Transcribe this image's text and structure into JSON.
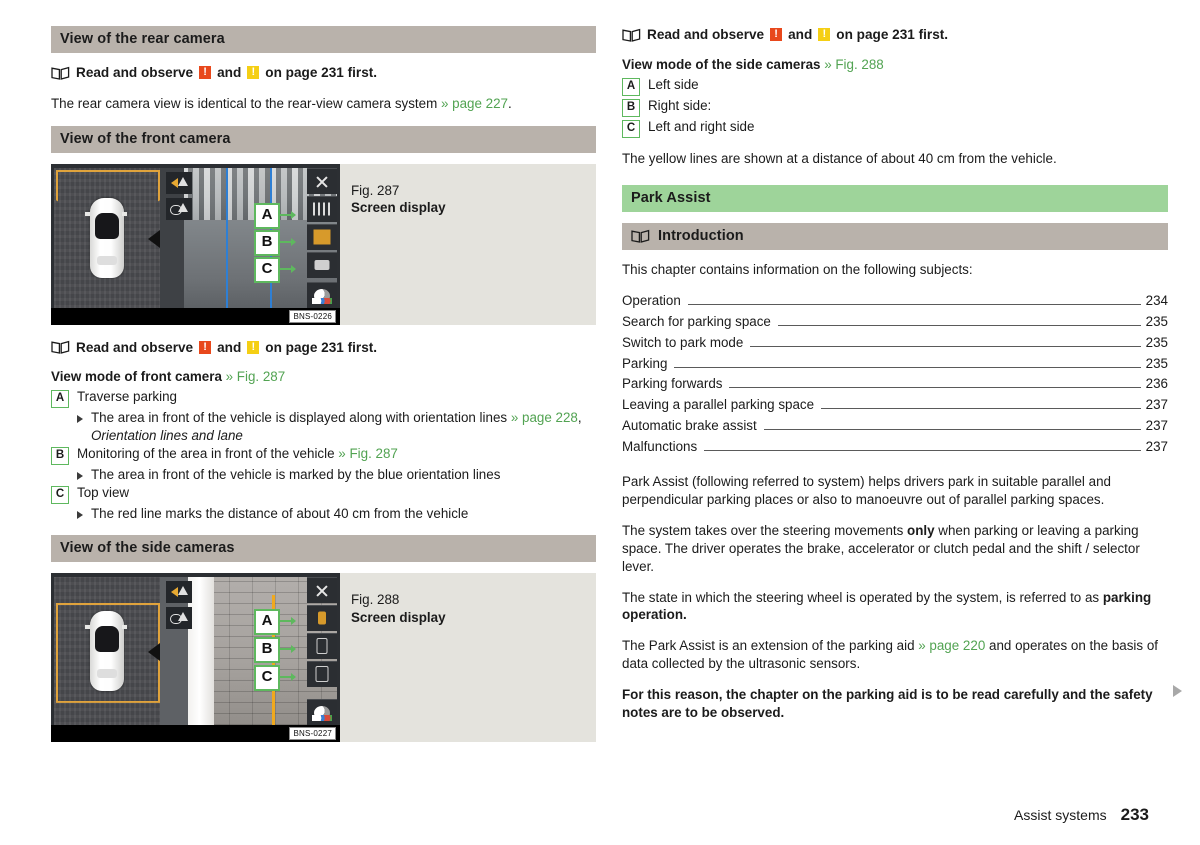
{
  "document": {
    "footer_chapter": "Assist systems",
    "footer_page": "233"
  },
  "left_column": {
    "section_rear": {
      "heading": "View of the rear camera",
      "note": {
        "prefix": "Read and observe",
        "middle": "and",
        "suffix": "on page 231 first.",
        "warn_red": "!",
        "warn_yellow": "!"
      },
      "paragraph": "The rear camera view is identical to the rear-view camera system",
      "paragraph_xref": "» page 227",
      "paragraph_end": "."
    },
    "section_front": {
      "heading": "View of the front camera",
      "figure": {
        "caption_line1": "Fig. 287",
        "caption_line2": "Screen display",
        "code": "BNS-0226",
        "callouts": [
          "A",
          "B",
          "C"
        ]
      },
      "note": {
        "prefix": "Read and observe",
        "middle": "and",
        "suffix": "on page 231 first.",
        "warn_red": "!",
        "warn_yellow": "!"
      },
      "subhead": "View mode of front camera",
      "subhead_xref": "» Fig. 287",
      "items": [
        {
          "letter": "A",
          "text": "Traverse parking",
          "bullets": [
            {
              "text": "The area in front of the vehicle is displayed along with orientation lines",
              "xref": "» page 228",
              "after_xref": ", ",
              "italic": "Orientation lines and lane"
            }
          ]
        },
        {
          "letter": "B",
          "text": "Monitoring of the area in front of the vehicle",
          "xref": "» Fig. 287",
          "bullets": [
            {
              "text": "The area in front of the vehicle is marked by the blue orientation lines"
            }
          ]
        },
        {
          "letter": "C",
          "text": "Top view",
          "bullets": [
            {
              "text": "The red line marks the distance of about 40 cm from the vehicle"
            }
          ]
        }
      ]
    },
    "section_side": {
      "heading": "View of the side cameras",
      "figure": {
        "caption_line1": "Fig. 288",
        "caption_line2": "Screen display",
        "code": "BNS-0227",
        "callouts": [
          "A",
          "B",
          "C"
        ]
      }
    }
  },
  "right_column": {
    "note": {
      "prefix": "Read and observe",
      "middle": "and",
      "suffix": "on page 231 first.",
      "warn_red": "!",
      "warn_yellow": "!"
    },
    "subhead": "View mode of the side cameras",
    "subhead_xref": "» Fig. 288",
    "items": [
      {
        "letter": "A",
        "text": "Left side"
      },
      {
        "letter": "B",
        "text": "Right side:"
      },
      {
        "letter": "C",
        "text": "Left and right side"
      }
    ],
    "yellow_note": "The yellow lines are shown at a distance of about 40 cm from the vehicle.",
    "chapter_bar": "Park Assist",
    "intro_bar": "Introduction",
    "intro_lead": "This chapter contains information on the following subjects:",
    "toc": [
      {
        "label": "Operation",
        "page": "234"
      },
      {
        "label": "Search for parking space",
        "page": "235"
      },
      {
        "label": "Switch to park mode",
        "page": "235"
      },
      {
        "label": "Parking",
        "page": "235"
      },
      {
        "label": "Parking forwards",
        "page": "236"
      },
      {
        "label": "Leaving a parallel parking space",
        "page": "237"
      },
      {
        "label": "Automatic brake assist",
        "page": "237"
      },
      {
        "label": "Malfunctions",
        "page": "237"
      }
    ],
    "paragraphs": {
      "p1": "Park Assist (following referred to system) helps drivers park in suitable parallel and perpendicular parking places or also to manoeuvre out of parallel parking spaces.",
      "p2_a": "The system takes over the steering movements ",
      "p2_b": "only",
      "p2_c": " when parking or leaving a parking space. The driver operates the brake, accelerator or clutch pedal and the shift / selector lever.",
      "p3_a": "The state in which the steering wheel is operated by the system, is referred to as ",
      "p3_b": "parking operation.",
      "p4_a": "The Park Assist is an extension of the parking aid ",
      "p4_xref": "» page 220",
      "p4_b": " and operates on the basis of data collected by the ultrasonic sensors.",
      "p5": "For this reason, the chapter on the parking aid is to be read carefully and the safety notes are to be observed."
    }
  },
  "colors": {
    "section_bar": "#b9b2ab",
    "chapter_bar": "#9ed49a",
    "xref_green": "#52a352",
    "badge_border": "#5eb85e",
    "warn_red": "#e8481c",
    "warn_yellow": "#f5cf14",
    "figure_bg": "#e4e3dd"
  }
}
